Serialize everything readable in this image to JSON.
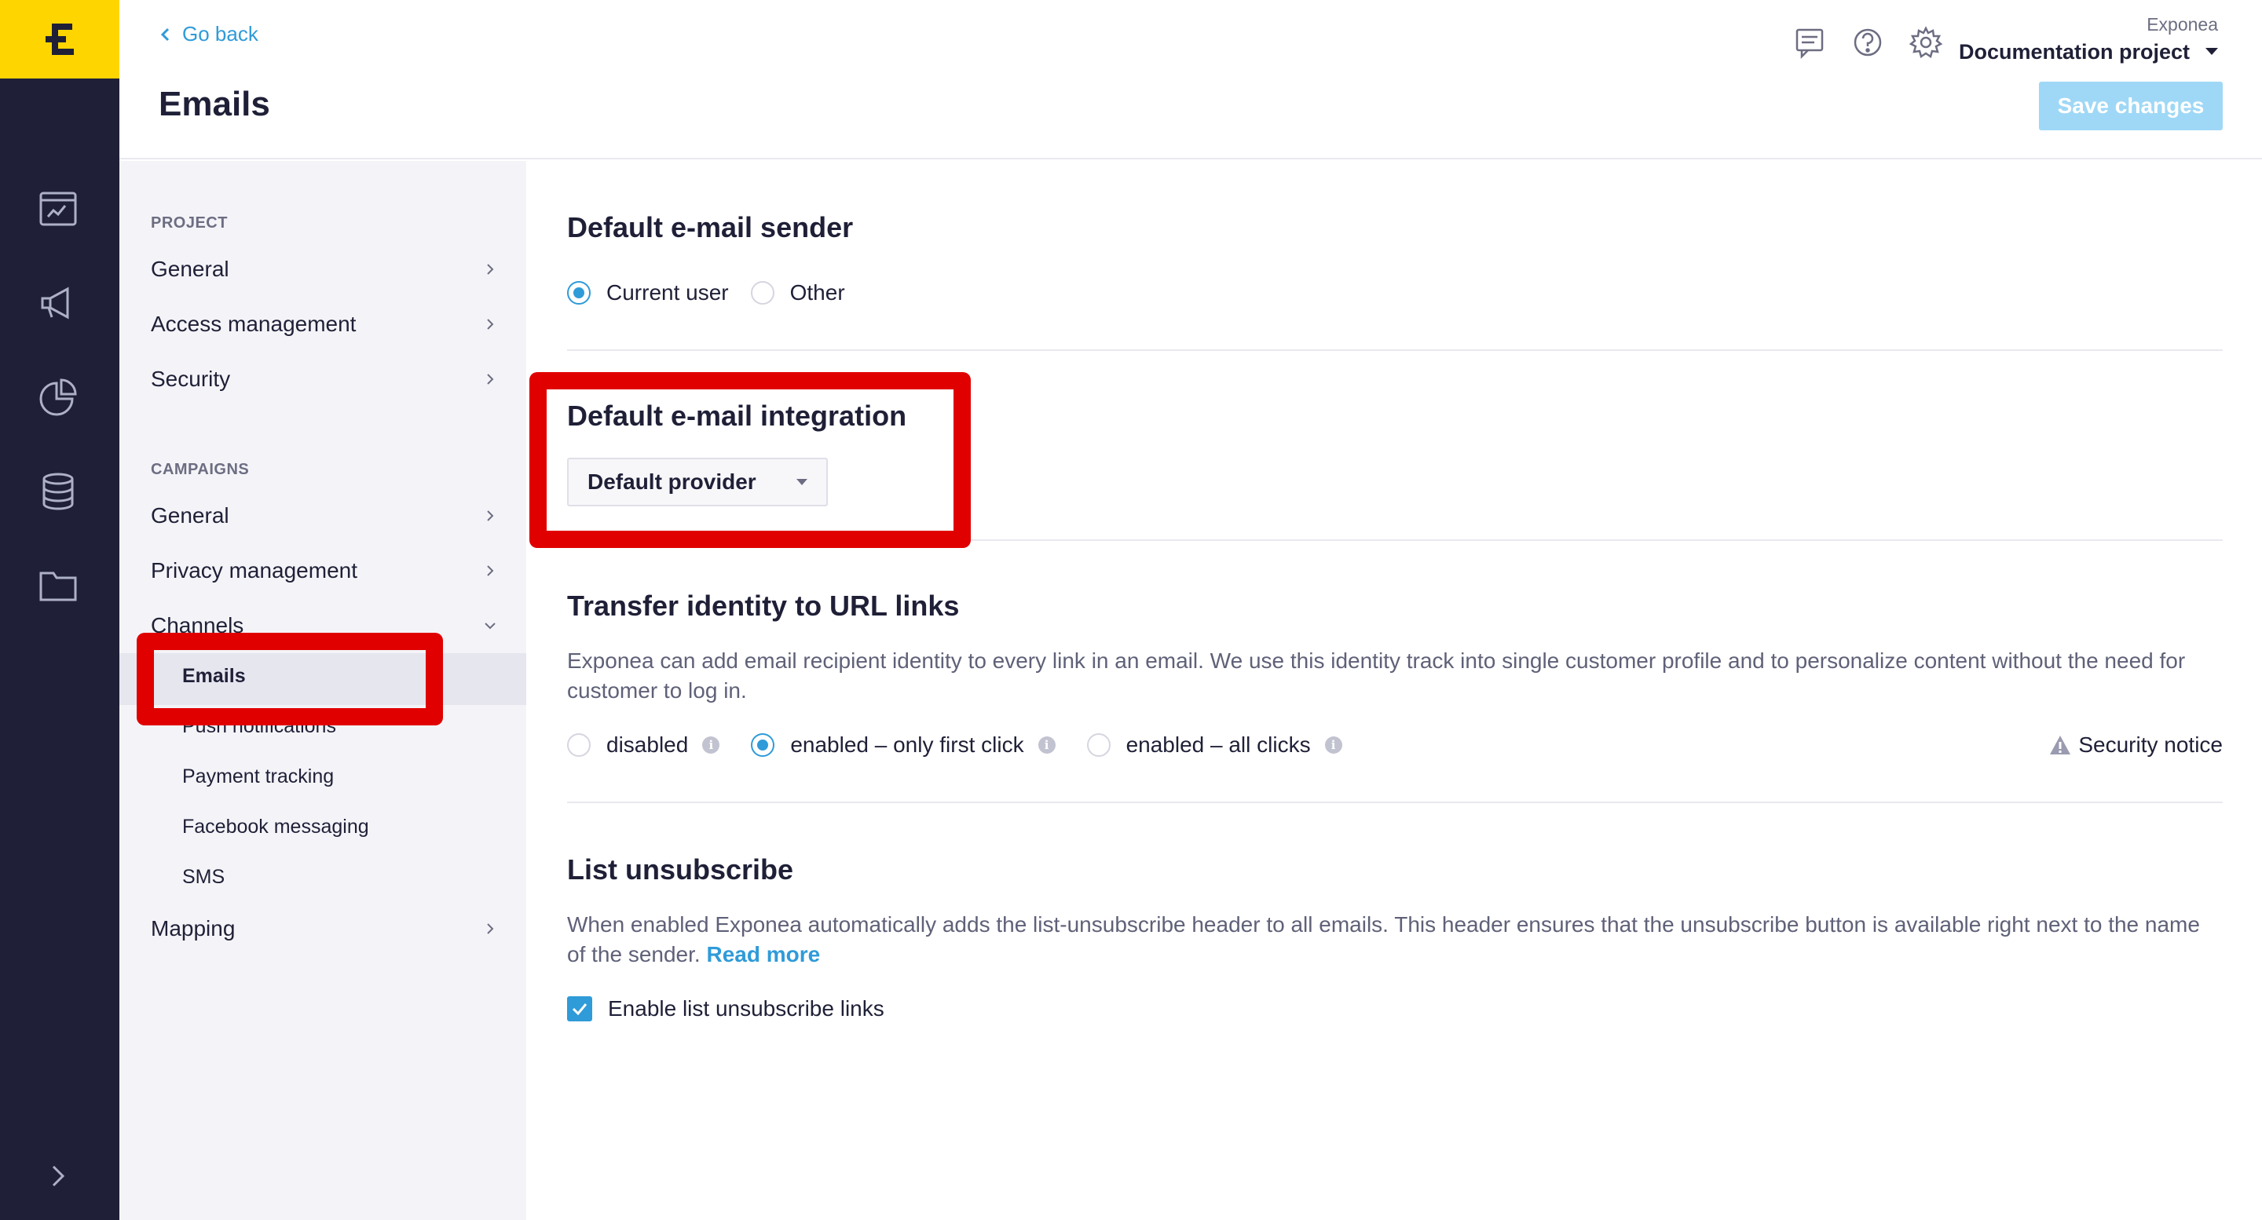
{
  "header": {
    "go_back": "Go back",
    "title": "Emails",
    "project_company": "Exponea",
    "project_name": "Documentation project",
    "save_label": "Save changes",
    "icons": [
      "chat-icon",
      "help-icon",
      "settings-icon"
    ]
  },
  "rail": {
    "items": [
      "calendar-chart-icon",
      "megaphone-icon",
      "pie-chart-icon",
      "database-icon",
      "folder-icon",
      "expand-arrow-icon"
    ]
  },
  "nav": {
    "project_section": "PROJECT",
    "project_items": [
      {
        "label": "General"
      },
      {
        "label": "Access management"
      },
      {
        "label": "Security"
      }
    ],
    "campaigns_section": "CAMPAIGNS",
    "campaign_items": [
      {
        "label": "General"
      },
      {
        "label": "Privacy management"
      },
      {
        "label": "Channels"
      }
    ],
    "channel_items": [
      {
        "label": "Emails",
        "active": true
      },
      {
        "label": "Push notifications"
      },
      {
        "label": "Payment tracking"
      },
      {
        "label": "Facebook messaging"
      },
      {
        "label": "SMS"
      }
    ],
    "mapping": "Mapping"
  },
  "content": {
    "sender": {
      "title": "Default e-mail sender",
      "options": [
        "Current user",
        "Other"
      ],
      "selected": "Current user"
    },
    "integration": {
      "title": "Default e-mail integration",
      "value": "Default provider"
    },
    "identity": {
      "title": "Transfer identity to URL links",
      "description": "Exponea can add email recipient identity to every link in an email. We use this identity track into single customer profile and to personalize content without the need for customer to log in.",
      "options": [
        "disabled",
        "enabled – only first click",
        "enabled – all clicks"
      ],
      "selected": "enabled – only first click",
      "info_glyph": "i",
      "security_notice": "Security notice"
    },
    "unsubscribe": {
      "title": "List unsubscribe",
      "description": "When enabled Exponea automatically adds the list-unsubscribe header to all emails. This header ensures that the unsubscribe button is available right next to the name of the sender.",
      "read_more": "Read more",
      "checkbox_label": "Enable list unsubscribe links",
      "checked": true
    }
  },
  "colors": {
    "rail": "#1f2037",
    "logo": "#ffd500",
    "accent": "#2f9bd8",
    "save_disabled": "#9fd8f6",
    "highlight": "#e00000"
  }
}
